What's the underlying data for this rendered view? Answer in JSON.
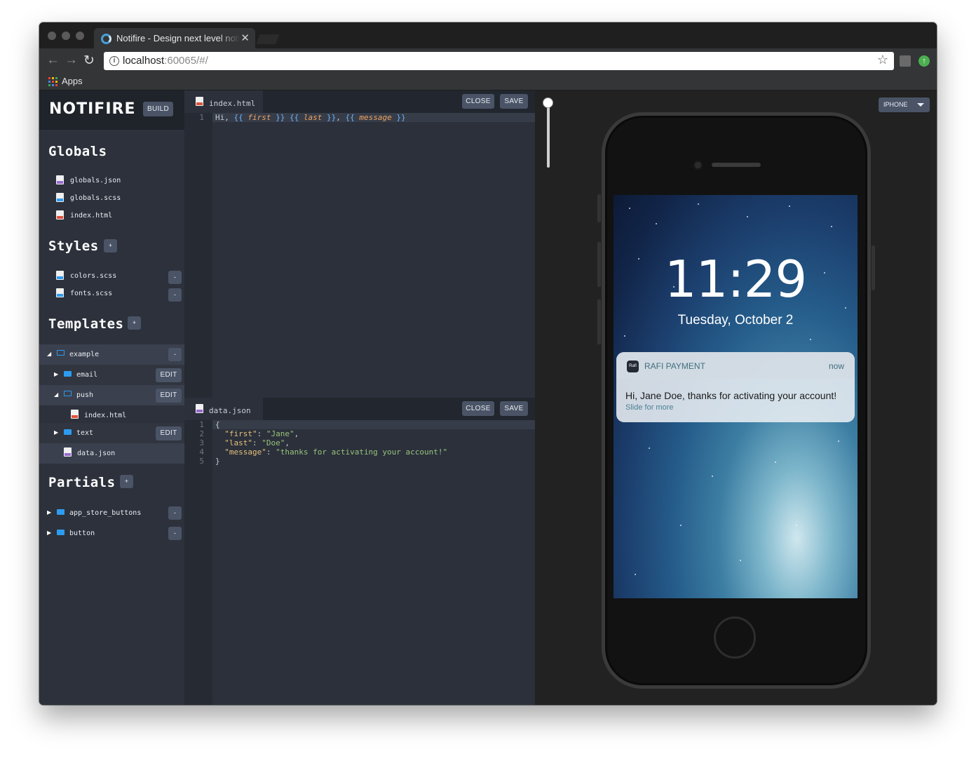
{
  "browser": {
    "tab_title": "Notifire - Design next level notifications",
    "tab_close": "✕",
    "url_host": "localhost",
    "url_rest": ":60065/#/",
    "bookmarks_apps": "Apps"
  },
  "sidebar": {
    "logo": "NOTIFIRE",
    "build_label": "BUILD",
    "globals_title": "Globals",
    "globals_files": [
      "globals.json",
      "globals.scss",
      "index.html"
    ],
    "styles_title": "Styles",
    "styles_files": [
      "colors.scss",
      "fonts.scss"
    ],
    "templates_title": "Templates",
    "templates": {
      "root": "example",
      "folders": [
        "email",
        "push",
        "text"
      ],
      "push_file": "index.html",
      "data_file": "data.json"
    },
    "partials_title": "Partials",
    "partials": [
      "app_store_buttons",
      "button"
    ],
    "add_label": "+",
    "remove_label": "-",
    "edit_label": "EDIT"
  },
  "editor_top": {
    "filename": "index.html",
    "close_label": "CLOSE",
    "save_label": "SAVE",
    "line_numbers": [
      "1"
    ],
    "code": {
      "prefix": "Hi, ",
      "open1": "{{ ",
      "var1": "first",
      "close1": " }}",
      "sp": " ",
      "open2": "{{ ",
      "var2": "last",
      "close2": " }}",
      "comma": ", ",
      "open3": "{{ ",
      "var3": "message",
      "close3": " }}"
    }
  },
  "editor_bottom": {
    "filename": "data.json",
    "close_label": "CLOSE",
    "save_label": "SAVE",
    "line_numbers": [
      "1",
      "2",
      "3",
      "4",
      "5"
    ],
    "lines": {
      "l1": "{",
      "k2": "\"first\"",
      "v2": "\"Jane\"",
      "k3": "\"last\"",
      "v3": "\"Doe\"",
      "k4": "\"message\"",
      "v4": "\"thanks for activating your account!\"",
      "l5": "}"
    }
  },
  "preview": {
    "device": "IPHONE",
    "time": "11:29",
    "date": "Tuesday, October 2",
    "notification": {
      "app_icon_text": "Rafi",
      "app_name": "RAFI PAYMENT",
      "time": "now",
      "body": "Hi, Jane Doe, thanks for activating your account!",
      "more": "Slide for more"
    }
  },
  "colors": {
    "sidebar_bg": "#2c313b",
    "editor_bg": "#2b303b",
    "button_bg": "#4a5466",
    "folder_blue": "#2d9cf0"
  }
}
